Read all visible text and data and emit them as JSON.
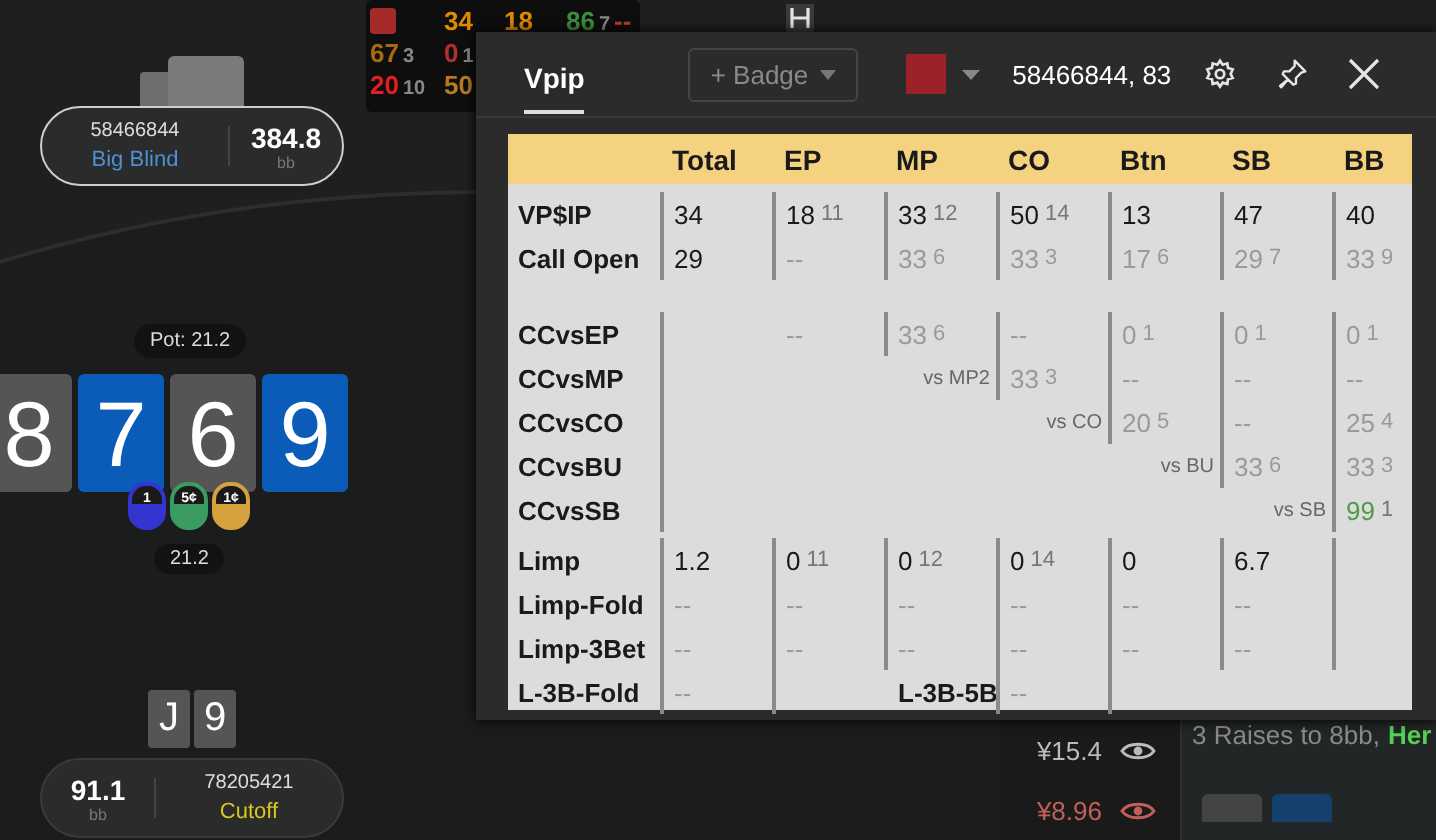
{
  "hud": {
    "rows": [
      [
        {
          "kind": "swatch",
          "color": "#a52a2a"
        },
        {
          "kind": "stat",
          "value": "34",
          "color": "#e08a00"
        },
        {
          "kind": "stat",
          "value": "18",
          "color": "#e08a00"
        },
        {
          "kind": "stat",
          "value": "86",
          "count": "7",
          "color": "#3d8f3d"
        },
        {
          "kind": "stat",
          "value": "--",
          "color": "#c0392b"
        }
      ],
      [
        {
          "kind": "stat",
          "value": "67",
          "count": "3",
          "color": "#a86a10"
        },
        {
          "kind": "stat",
          "value": "0",
          "count": "1",
          "color": "#b03030"
        }
      ],
      [
        {
          "kind": "stat",
          "value": "20",
          "count": "10",
          "color": "#e02020"
        },
        {
          "kind": "stat",
          "value": "50",
          "color": "#b87a20"
        }
      ]
    ]
  },
  "top_seat": {
    "player": "58466844",
    "position": "Big Blind",
    "stack": "384.8",
    "unit": "bb"
  },
  "pot": "Pot: 21.2",
  "board": [
    {
      "rank": "8",
      "color": "#555555"
    },
    {
      "rank": "7",
      "color": "#0a5cb8"
    },
    {
      "rank": "6",
      "color": "#555555"
    },
    {
      "rank": "9",
      "color": "#0a5cb8"
    }
  ],
  "chips": [
    {
      "label": "1",
      "color": "#3434d0"
    },
    {
      "label": "5¢",
      "color": "#3a9c62"
    },
    {
      "label": "1¢",
      "color": "#d6a23e"
    }
  ],
  "bet": "21.2",
  "hero_cards": [
    {
      "rank": "J"
    },
    {
      "rank": "9"
    }
  ],
  "hero_seat": {
    "stack": "91.1",
    "unit": "bb",
    "player": "78205421",
    "position": "Cutoff"
  },
  "side_list": [
    {
      "amount": "¥15.4",
      "color": "#bbbbbb"
    },
    {
      "amount": "¥8.96",
      "color": "#c0605a"
    }
  ],
  "log": {
    "text": "3 Raises to 8bb,",
    "name": "Her"
  },
  "popup": {
    "tabs": [
      {
        "label": "Vpip",
        "selected": true
      }
    ],
    "badge_button": "+ Badge",
    "swatch": {
      "color": "#9b2226"
    },
    "title": "58466844, 83",
    "table": {
      "columns": [
        "Total",
        "EP",
        "MP",
        "CO",
        "Btn",
        "SB",
        "BB"
      ],
      "groups": [
        {
          "rows": [
            {
              "label": "VP$IP",
              "cells": [
                {
                  "kind": "stat",
                  "value": "34",
                  "dim": false,
                  "bar": true
                },
                {
                  "kind": "stat",
                  "value": "18",
                  "count": "11",
                  "dim": false,
                  "bar": true
                },
                {
                  "kind": "stat",
                  "value": "33",
                  "count": "12",
                  "dim": false,
                  "bar": true
                },
                {
                  "kind": "stat",
                  "value": "50",
                  "count": "14",
                  "dim": false,
                  "bar": true
                },
                {
                  "kind": "stat",
                  "value": "13",
                  "dim": false,
                  "bar": true
                },
                {
                  "kind": "stat",
                  "value": "47",
                  "dim": false,
                  "bar": true
                },
                {
                  "kind": "stat",
                  "value": "40",
                  "dim": false,
                  "bar": true
                }
              ]
            },
            {
              "label": "Call Open",
              "cells": [
                {
                  "kind": "stat",
                  "value": "29",
                  "dim": false,
                  "bar": true
                },
                {
                  "kind": "stat",
                  "value": "--",
                  "dim": true,
                  "bar": true
                },
                {
                  "kind": "stat",
                  "value": "33",
                  "count": "6",
                  "dim": true,
                  "bar": true
                },
                {
                  "kind": "stat",
                  "value": "33",
                  "count": "3",
                  "dim": true,
                  "bar": true
                },
                {
                  "kind": "stat",
                  "value": "17",
                  "count": "6",
                  "dim": true,
                  "bar": true
                },
                {
                  "kind": "stat",
                  "value": "29",
                  "count": "7",
                  "dim": true,
                  "bar": true
                },
                {
                  "kind": "stat",
                  "value": "33",
                  "count": "9",
                  "dim": true,
                  "bar": true
                }
              ]
            }
          ]
        },
        {
          "rows": [
            {
              "label": "CCvsEP",
              "cells": [
                {
                  "kind": "empty",
                  "bar": true
                },
                {
                  "kind": "stat",
                  "value": "--",
                  "dim": true,
                  "bar": false
                },
                {
                  "kind": "stat",
                  "value": "33",
                  "count": "6",
                  "dim": true,
                  "bar": true
                },
                {
                  "kind": "stat",
                  "value": "--",
                  "dim": true,
                  "bar": true
                },
                {
                  "kind": "stat",
                  "value": "0",
                  "count": "1",
                  "dim": true,
                  "bar": true
                },
                {
                  "kind": "stat",
                  "value": "0",
                  "count": "1",
                  "dim": true,
                  "bar": true
                },
                {
                  "kind": "stat",
                  "value": "0",
                  "count": "1",
                  "dim": true,
                  "bar": true
                }
              ]
            },
            {
              "label": "CCvsMP",
              "cells": [
                {
                  "kind": "empty",
                  "bar": true
                },
                {
                  "kind": "empty",
                  "bar": false
                },
                {
                  "kind": "note",
                  "value": "vs MP2"
                },
                {
                  "kind": "stat",
                  "value": "33",
                  "count": "3",
                  "dim": true,
                  "bar": true
                },
                {
                  "kind": "stat",
                  "value": "--",
                  "dim": true,
                  "bar": true
                },
                {
                  "kind": "stat",
                  "value": "--",
                  "dim": true,
                  "bar": true
                },
                {
                  "kind": "stat",
                  "value": "--",
                  "dim": true,
                  "bar": true
                }
              ]
            },
            {
              "label": "CCvsCO",
              "cells": [
                {
                  "kind": "empty",
                  "bar": true
                },
                {
                  "kind": "empty",
                  "bar": false
                },
                {
                  "kind": "empty",
                  "bar": false
                },
                {
                  "kind": "note",
                  "value": "vs CO"
                },
                {
                  "kind": "stat",
                  "value": "20",
                  "count": "5",
                  "dim": true,
                  "bar": true
                },
                {
                  "kind": "stat",
                  "value": "--",
                  "dim": true,
                  "bar": true
                },
                {
                  "kind": "stat",
                  "value": "25",
                  "count": "4",
                  "dim": true,
                  "bar": true
                }
              ]
            },
            {
              "label": "CCvsBU",
              "cells": [
                {
                  "kind": "empty",
                  "bar": true
                },
                {
                  "kind": "empty",
                  "bar": false
                },
                {
                  "kind": "empty",
                  "bar": false
                },
                {
                  "kind": "empty",
                  "bar": false
                },
                {
                  "kind": "note",
                  "value": "vs BU"
                },
                {
                  "kind": "stat",
                  "value": "33",
                  "count": "6",
                  "dim": true,
                  "bar": true
                },
                {
                  "kind": "stat",
                  "value": "33",
                  "count": "3",
                  "dim": true,
                  "bar": true
                }
              ]
            },
            {
              "label": "CCvsSB",
              "cells": [
                {
                  "kind": "empty",
                  "bar": true
                },
                {
                  "kind": "empty",
                  "bar": false
                },
                {
                  "kind": "empty",
                  "bar": false
                },
                {
                  "kind": "empty",
                  "bar": false
                },
                {
                  "kind": "empty",
                  "bar": false
                },
                {
                  "kind": "note",
                  "value": "vs SB"
                },
                {
                  "kind": "highlight",
                  "value": "99",
                  "count": "1",
                  "bar": true
                }
              ]
            }
          ]
        },
        {
          "rows": [
            {
              "label": "Limp",
              "cells": [
                {
                  "kind": "stat",
                  "value": "1.2",
                  "dim": false,
                  "bar": true
                },
                {
                  "kind": "stat",
                  "value": "0",
                  "count": "11",
                  "dim": false,
                  "bar": true
                },
                {
                  "kind": "stat",
                  "value": "0",
                  "count": "12",
                  "dim": false,
                  "bar": true
                },
                {
                  "kind": "stat",
                  "value": "0",
                  "count": "14",
                  "dim": false,
                  "bar": true
                },
                {
                  "kind": "stat",
                  "value": "0",
                  "dim": false,
                  "bar": true
                },
                {
                  "kind": "stat",
                  "value": "6.7",
                  "dim": false,
                  "bar": true
                },
                {
                  "kind": "empty",
                  "bar": true
                }
              ]
            },
            {
              "label": "Limp-Fold",
              "cells": [
                {
                  "kind": "stat",
                  "value": "--",
                  "dim": true,
                  "bar": true
                },
                {
                  "kind": "stat",
                  "value": "--",
                  "dim": true,
                  "bar": true
                },
                {
                  "kind": "stat",
                  "value": "--",
                  "dim": true,
                  "bar": true
                },
                {
                  "kind": "stat",
                  "value": "--",
                  "dim": true,
                  "bar": true
                },
                {
                  "kind": "stat",
                  "value": "--",
                  "dim": true,
                  "bar": true
                },
                {
                  "kind": "stat",
                  "value": "--",
                  "dim": true,
                  "bar": true
                },
                {
                  "kind": "empty",
                  "bar": true
                }
              ]
            },
            {
              "label": "Limp-3Bet",
              "cells": [
                {
                  "kind": "stat",
                  "value": "--",
                  "dim": true,
                  "bar": true
                },
                {
                  "kind": "stat",
                  "value": "--",
                  "dim": true,
                  "bar": true
                },
                {
                  "kind": "stat",
                  "value": "--",
                  "dim": true,
                  "bar": true
                },
                {
                  "kind": "stat",
                  "value": "--",
                  "dim": true,
                  "bar": true
                },
                {
                  "kind": "stat",
                  "value": "--",
                  "dim": true,
                  "bar": true
                },
                {
                  "kind": "stat",
                  "value": "--",
                  "dim": true,
                  "bar": true
                },
                {
                  "kind": "empty",
                  "bar": true
                }
              ]
            },
            {
              "label": "L-3B-Fold",
              "cells": [
                {
                  "kind": "stat",
                  "value": "--",
                  "dim": true,
                  "bar": true
                },
                {
                  "kind": "empty",
                  "bar": true
                },
                {
                  "kind": "heading",
                  "value": "L-3B-5B"
                },
                {
                  "kind": "stat",
                  "value": "--",
                  "dim": true,
                  "bar": true
                },
                {
                  "kind": "empty",
                  "bar": true
                },
                {
                  "kind": "empty",
                  "bar": false
                },
                {
                  "kind": "empty",
                  "bar": false
                }
              ]
            }
          ]
        }
      ]
    }
  }
}
